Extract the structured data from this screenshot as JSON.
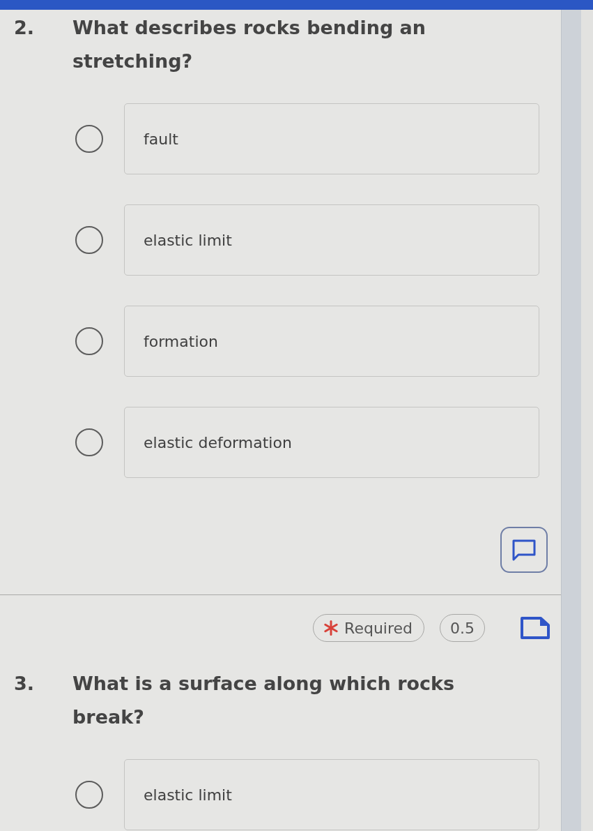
{
  "questions": [
    {
      "number": "2.",
      "text": "What describes rocks bending an stretching?",
      "options": [
        {
          "label": "fault",
          "selected": false
        },
        {
          "label": "elastic limit",
          "selected": false
        },
        {
          "label": "formation",
          "selected": false
        },
        {
          "label": "elastic deformation",
          "selected": false
        }
      ],
      "footer": {
        "required": true,
        "required_label": "Required",
        "points": "0.5"
      }
    },
    {
      "number": "3.",
      "text": "What is a surface along which rocks break?",
      "options": [
        {
          "label": "elastic limit",
          "selected": false
        }
      ]
    }
  ]
}
